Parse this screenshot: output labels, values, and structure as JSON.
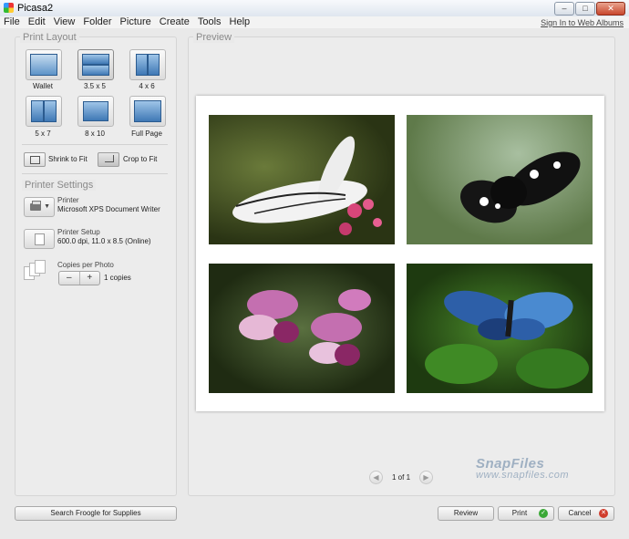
{
  "window": {
    "title": "Picasa2",
    "controls": [
      "minimize",
      "maximize",
      "close"
    ]
  },
  "menu": [
    "File",
    "Edit",
    "View",
    "Folder",
    "Picture",
    "Create",
    "Tools",
    "Help"
  ],
  "signin_link": "Sign In to Web Albums",
  "print_layout": {
    "title": "Print Layout",
    "options": [
      {
        "label": "Wallet",
        "selected": false
      },
      {
        "label": "3.5 x 5",
        "selected": true
      },
      {
        "label": "4 x 6",
        "selected": false
      },
      {
        "label": "5 x 7",
        "selected": false
      },
      {
        "label": "8 x 10",
        "selected": false
      },
      {
        "label": "Full Page",
        "selected": false
      }
    ],
    "shrink_to_fit": "Shrink to Fit",
    "crop_to_fit": "Crop to Fit"
  },
  "printer_settings": {
    "title": "Printer Settings",
    "printer_label": "Printer",
    "printer_value": "Microsoft XPS Document Writer",
    "setup_label": "Printer Setup",
    "setup_value": "600.0 dpi, 11.0 x 8.5 (Online)",
    "copies_label": "Copies per Photo",
    "copies_value": "1 copies",
    "minus": "–",
    "plus": "+"
  },
  "preview": {
    "title": "Preview",
    "photos": [
      {
        "subject": "white-black-butterfly-on-pink-flowers"
      },
      {
        "subject": "black-white-butterfly-on-green"
      },
      {
        "subject": "purple-orchids"
      },
      {
        "subject": "blue-morpho-butterfly-on-leaves"
      }
    ],
    "page_indicator": "1 of 1",
    "prev_icon": "◀",
    "next_icon": "▶"
  },
  "watermark": {
    "brand": "SnapFiles",
    "url": "www.snapfiles.com"
  },
  "buttons": {
    "search": "Search Froogle for Supplies",
    "review": "Review",
    "print": "Print",
    "cancel": "Cancel",
    "print_badge": "✓",
    "cancel_badge": "✕"
  },
  "colors": {
    "print_badge": "#3aa836",
    "cancel_badge": "#d03c2c",
    "panel_title": "#8a8a8a"
  }
}
